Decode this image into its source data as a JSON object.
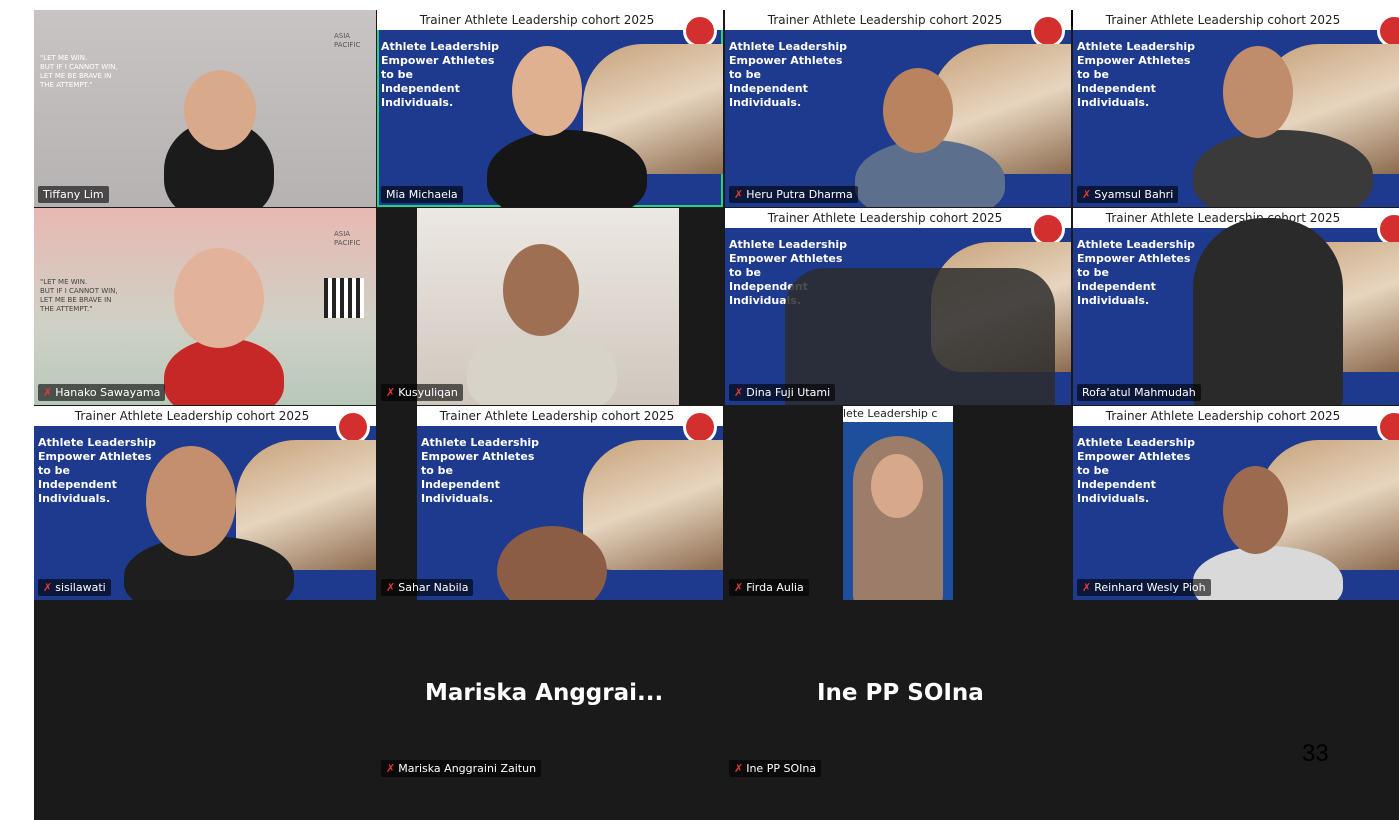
{
  "banner_title": "Trainer Athlete Leadership cohort 2025",
  "banner_slogan": [
    "Athlete Leadership",
    "Empower Athletes",
    "to be",
    "Independent",
    "Individuals."
  ],
  "tiles": [
    {
      "name": "Tiffany Lim"
    },
    {
      "name": "Mia Michaela"
    },
    {
      "name": "Heru Putra Dharma"
    },
    {
      "name": "Syamsul Bahri"
    },
    {
      "name": "Hanako Sawayama"
    },
    {
      "name": "Kusyuliqan"
    },
    {
      "name": "Dina Fuji Utami"
    },
    {
      "name": "Rofa'atul Mahmudah"
    },
    {
      "name": "sisilawati"
    },
    {
      "name": "Sahar Nabila"
    },
    {
      "name": "Firda Aulia"
    },
    {
      "name": "Reinhard Wesly Pioh"
    }
  ],
  "poster_quote": [
    "\"LET ME WIN.",
    "BUT IF I CANNOT WIN,",
    "LET ME BE BRAVE IN",
    "THE ATTEMPT.\""
  ],
  "poster_asia": [
    "ASIA",
    "PACIFIC"
  ],
  "partial_banner_title": "lete Leadership c",
  "audio_only": [
    {
      "display": "Mariska  Anggrai...",
      "tag": "Mariska Anggraini Zaitun"
    },
    {
      "display": "Ine PP SOIna",
      "tag": "Ine PP SOIna"
    }
  ],
  "slide_number": "33",
  "colors": {
    "background": "#1a1a1a",
    "active_speaker": "#23d18b",
    "banner_blue": "#1d3a8f",
    "muted": "#e53935"
  }
}
